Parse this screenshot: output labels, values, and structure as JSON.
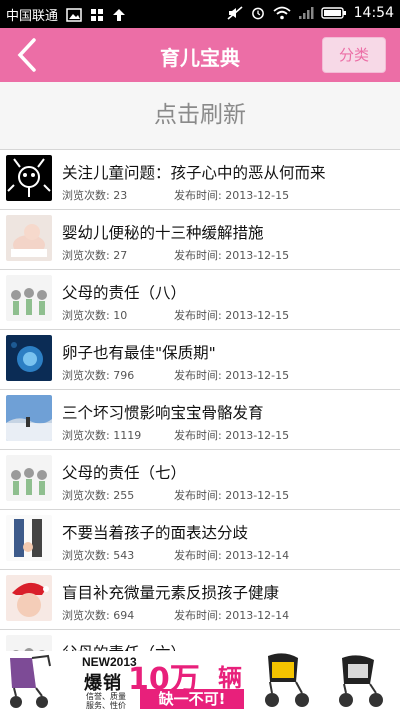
{
  "status": {
    "carrier": "中国联通",
    "time": "14:54",
    "icons": [
      "image-icon",
      "grid-icon",
      "upload-arrow-icon",
      "mute-icon",
      "alarm-icon",
      "wifi-icon",
      "signal-icon",
      "battery-icon"
    ]
  },
  "header": {
    "title": "育儿宝典",
    "category_label": "分类",
    "back_icon": "chevron-left-icon",
    "color": "#ec6ea6"
  },
  "refresh_label": "点击刷新",
  "items": [
    {
      "title": "关注儿童问题：孩子心中的恶从何而来",
      "views_label": "浏览次数: 23",
      "date_label": "发布时间: 2013-12-15"
    },
    {
      "title": "婴幼儿便秘的十三种缓解措施",
      "views_label": "浏览次数: 27",
      "date_label": "发布时间: 2013-12-15"
    },
    {
      "title": "父母的责任（八）",
      "views_label": "浏览次数: 10",
      "date_label": "发布时间: 2013-12-15"
    },
    {
      "title": "卵子也有最佳\"保质期\"",
      "views_label": "浏览次数: 796",
      "date_label": "发布时间: 2013-12-15"
    },
    {
      "title": "三个坏习惯影响宝宝骨骼发育",
      "views_label": "浏览次数: 1119",
      "date_label": "发布时间: 2013-12-15"
    },
    {
      "title": "父母的责任（七）",
      "views_label": "浏览次数: 255",
      "date_label": "发布时间: 2013-12-15"
    },
    {
      "title": "不要当着孩子的面表达分歧",
      "views_label": "浏览次数: 543",
      "date_label": "发布时间: 2013-12-14"
    },
    {
      "title": "盲目补充微量元素反损孩子健康",
      "views_label": "浏览次数: 694",
      "date_label": "发布时间: 2013-12-14"
    },
    {
      "title": "父母的责任（六）",
      "views_label": "",
      "date_label": ""
    }
  ],
  "ad": {
    "brand": "NEW2013",
    "headline_a": "爆销",
    "headline_b": "10万",
    "headline_c": "辆",
    "tagline": "缺一不可!",
    "sub_tags": [
      "信誉、质量",
      "服务、性价"
    ]
  }
}
